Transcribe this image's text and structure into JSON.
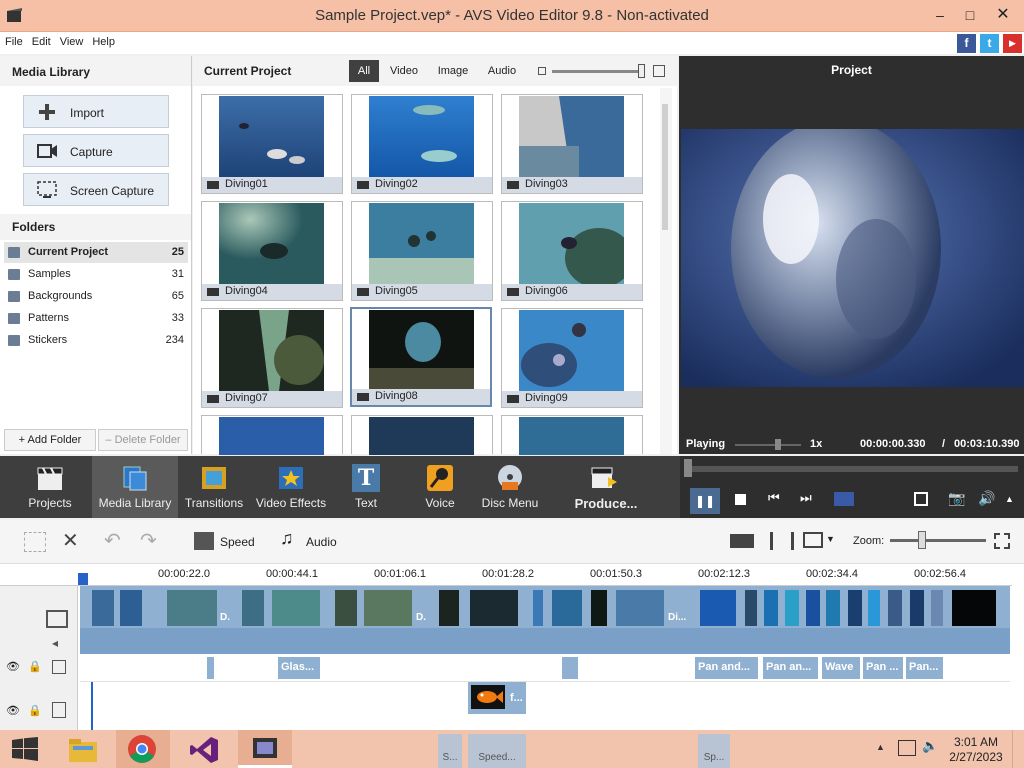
{
  "window": {
    "title": "Sample Project.vep* - AVS Video Editor 9.8 - Non-activated",
    "minimize": "–",
    "maximize": "□",
    "close": "✕"
  },
  "menu": [
    "File",
    "Edit",
    "View",
    "Help"
  ],
  "social": {
    "facebook": "f",
    "twitter": "t",
    "youtube": "▶"
  },
  "media_library": {
    "title": "Media Library",
    "import_label": "Import",
    "capture_label": "Capture",
    "screen_capture_label": "Screen Capture",
    "folders_title": "Folders",
    "folders": [
      {
        "name": "Current Project",
        "count": "25"
      },
      {
        "name": "Samples",
        "count": "31"
      },
      {
        "name": "Backgrounds",
        "count": "65"
      },
      {
        "name": "Patterns",
        "count": "33"
      },
      {
        "name": "Stickers",
        "count": "234"
      }
    ],
    "add_folder": "Add Folder",
    "delete_folder": "Delete Folder"
  },
  "project_files": {
    "title": "Current Project",
    "filters": [
      "All",
      "Video",
      "Image",
      "Audio"
    ],
    "clips": [
      "Diving01",
      "Diving02",
      "Diving03",
      "Diving04",
      "Diving05",
      "Diving06",
      "Diving07",
      "Diving08",
      "Diving09"
    ]
  },
  "preview": {
    "title": "Project",
    "status": "Playing",
    "speed": "1x",
    "current_time": "00:00:00.330",
    "separator": "/",
    "total_time": "00:03:10.390"
  },
  "tools": {
    "projects": "Projects",
    "media_library": "Media Library",
    "transitions": "Transitions",
    "video_effects": "Video Effects",
    "text": "Text",
    "voice": "Voice",
    "disc_menu": "Disc Menu",
    "produce": "Produce..."
  },
  "timeline_toolbar": {
    "speed": "Speed",
    "audio": "Audio",
    "zoom": "Zoom:"
  },
  "ruler": [
    "00:00:22.0",
    "00:00:44.1",
    "00:01:06.1",
    "00:01:28.2",
    "00:01:50.3",
    "00:02:12.3",
    "00:02:34.4",
    "00:02:56.4"
  ],
  "video_clip_labels": [
    "D.",
    "D.",
    "Di..."
  ],
  "effects": [
    "Glas...",
    "Pan and...",
    "Pan an...",
    "Wave",
    "Pan ...",
    "Pan..."
  ],
  "overlay": {
    "label": "f..."
  },
  "hidden_track": [
    "S...",
    "Speed...",
    "Sp..."
  ],
  "taskbar": {
    "time": "3:01 AM",
    "date": "2/27/2023"
  },
  "colors": {
    "titlebar": "#f6c0a6",
    "taskbar": "#f2c4ae",
    "toolband": "#3e3e3e",
    "clip_blue": "#8fb0d0"
  }
}
